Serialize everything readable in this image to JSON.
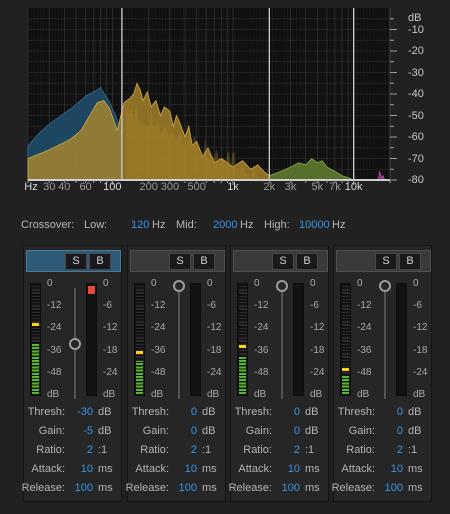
{
  "spectrum": {
    "x_labels": [
      {
        "text": "Hz",
        "hz": 20,
        "major": true
      },
      {
        "text": "30",
        "hz": 30
      },
      {
        "text": "40",
        "hz": 40
      },
      {
        "text": "60",
        "hz": 60
      },
      {
        "text": "100",
        "hz": 100,
        "major": true
      },
      {
        "text": "200",
        "hz": 200
      },
      {
        "text": "300",
        "hz": 300
      },
      {
        "text": "500",
        "hz": 500
      },
      {
        "text": "1k",
        "hz": 1000,
        "major": true
      },
      {
        "text": "2k",
        "hz": 2000
      },
      {
        "text": "3k",
        "hz": 3000
      },
      {
        "text": "5k",
        "hz": 5000
      },
      {
        "text": "7k",
        "hz": 7000
      },
      {
        "text": "10k",
        "hz": 10000,
        "major": true
      }
    ],
    "unit_label": "dB",
    "y_labels": [
      "-10",
      "-20",
      "-30",
      "-40",
      "-50",
      "-60",
      "-70",
      "-80"
    ],
    "crossover_lines_hz": [
      120,
      2000,
      10000
    ],
    "colors": {
      "low": "#1f4a66",
      "lowmid": "#b08a2a",
      "highmid": "#5e7a2e",
      "high": "#8a2a7a"
    }
  },
  "crossover": {
    "title": "Crossover:",
    "low_label": "Low:",
    "low_value": "120",
    "low_unit": "Hz",
    "mid_label": "Mid:",
    "mid_value": "2000",
    "mid_unit": "Hz",
    "high_label": "High:",
    "high_value": "10000",
    "high_unit": "Hz"
  },
  "scale_labels": [
    "0",
    "-12",
    "-24",
    "-36",
    "-48",
    "dB"
  ],
  "gr_labels": [
    "0",
    "-6",
    "-12",
    "-18",
    "-24",
    "dB"
  ],
  "bands": [
    {
      "active": true,
      "solo": "S",
      "bypass": "B",
      "level": 0.46,
      "peak": 0.62,
      "gr": 0.05,
      "gr_red": true,
      "thresh_pos": 0.52,
      "thresh": "-30",
      "thresh_unit": "dB",
      "gain": "-5",
      "gain_unit": "dB",
      "ratio": "2",
      "ratio_unit": ":1",
      "attack": "10",
      "attack_unit": "ms",
      "release": "100",
      "release_unit": "ms"
    },
    {
      "active": false,
      "solo": "S",
      "bypass": "B",
      "level": 0.3,
      "peak": 0.37,
      "gr": 0,
      "thresh_pos": 0,
      "thresh": "0",
      "thresh_unit": "dB",
      "gain": "0",
      "gain_unit": "dB",
      "ratio": "2",
      "ratio_unit": ":1",
      "attack": "10",
      "attack_unit": "ms",
      "release": "100",
      "release_unit": "ms"
    },
    {
      "active": false,
      "solo": "S",
      "bypass": "B",
      "level": 0.34,
      "peak": 0.42,
      "gr": 0,
      "thresh_pos": 0,
      "thresh": "0",
      "thresh_unit": "dB",
      "gain": "0",
      "gain_unit": "dB",
      "ratio": "2",
      "ratio_unit": ":1",
      "attack": "10",
      "attack_unit": "ms",
      "release": "100",
      "release_unit": "ms"
    },
    {
      "active": false,
      "solo": "S",
      "bypass": "B",
      "level": 0.16,
      "peak": 0.22,
      "gr": 0,
      "thresh_pos": 0,
      "thresh": "0",
      "thresh_unit": "dB",
      "gain": "0",
      "gain_unit": "dB",
      "ratio": "2",
      "ratio_unit": ":1",
      "attack": "10",
      "attack_unit": "ms",
      "release": "100",
      "release_unit": "ms"
    }
  ],
  "param_labels": {
    "thresh": "Thresh:",
    "gain": "Gain:",
    "ratio": "Ratio:",
    "attack": "Attack:",
    "release": "Release:"
  }
}
